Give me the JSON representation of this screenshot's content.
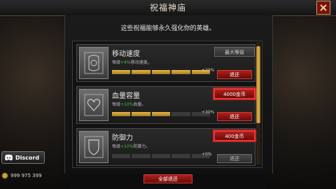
{
  "header": {
    "title": "祝福神庙"
  },
  "subtitle": "这些祝福能够永久强化你的英雄。",
  "blessings": [
    {
      "name": "移动速度",
      "desc_prefix": "每级",
      "desc_bonus": "+4%",
      "desc_suffix": "移动速度。",
      "filled": 5,
      "total": 5,
      "percent": "+20%",
      "cost_label": "最大等级",
      "refund_label": "退还"
    },
    {
      "name": "血量容量",
      "desc_prefix": "每级",
      "desc_bonus": "+10%",
      "desc_suffix": "血量。",
      "filled": 3,
      "total": 5,
      "percent": "+30%",
      "cost_label": "4000金币",
      "refund_label": "退还"
    },
    {
      "name": "防御力",
      "desc_prefix": "每级",
      "desc_bonus": "+10%",
      "desc_suffix": "防御力。",
      "filled": 0,
      "total": 5,
      "percent": "+0%",
      "cost_label": "400金币",
      "refund_label": "退还"
    }
  ],
  "refund_all_label": "全部退还",
  "discord_label": "Discord",
  "currency_value": "999 975 399",
  "colors": {
    "accent_red": "#b0201a",
    "gold": "#e2b64a",
    "bonus_green": "#4fb84f"
  }
}
